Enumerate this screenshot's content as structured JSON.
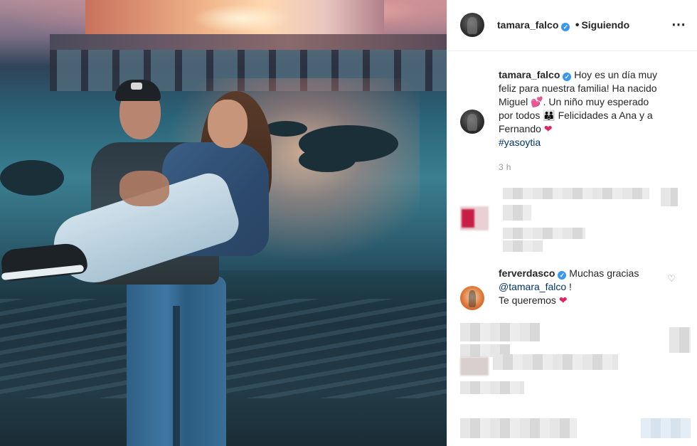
{
  "post": {
    "author": "tamara_falco",
    "follow_status": "Siguiendo",
    "more_icon": "⋯",
    "caption": {
      "author": "tamara_falco",
      "line1": "Hoy es un día muy",
      "line2": "feliz para nuestra familia! Ha nacido",
      "line3_text": "Miguel",
      "line3_emoji": "💕",
      "line3_rest": ". Un niño muy esperado",
      "line4_text": "por todos",
      "line4_emoji": "👪",
      "line4_rest": " Felicidades a Ana y a",
      "line5_text": "Fernando",
      "line5_emoji": "❤",
      "hashtag": "#yasoytia"
    },
    "time_ago": "3 h"
  },
  "reply": {
    "author": "ferverdasco",
    "text1": "Muchas gracias",
    "mention": "@tamara_falco",
    "text2": "!",
    "text3": "Te queremos",
    "emoji": "❤"
  },
  "colors": {
    "link": "#003569",
    "verified": "#3897f0",
    "muted": "#999999"
  }
}
